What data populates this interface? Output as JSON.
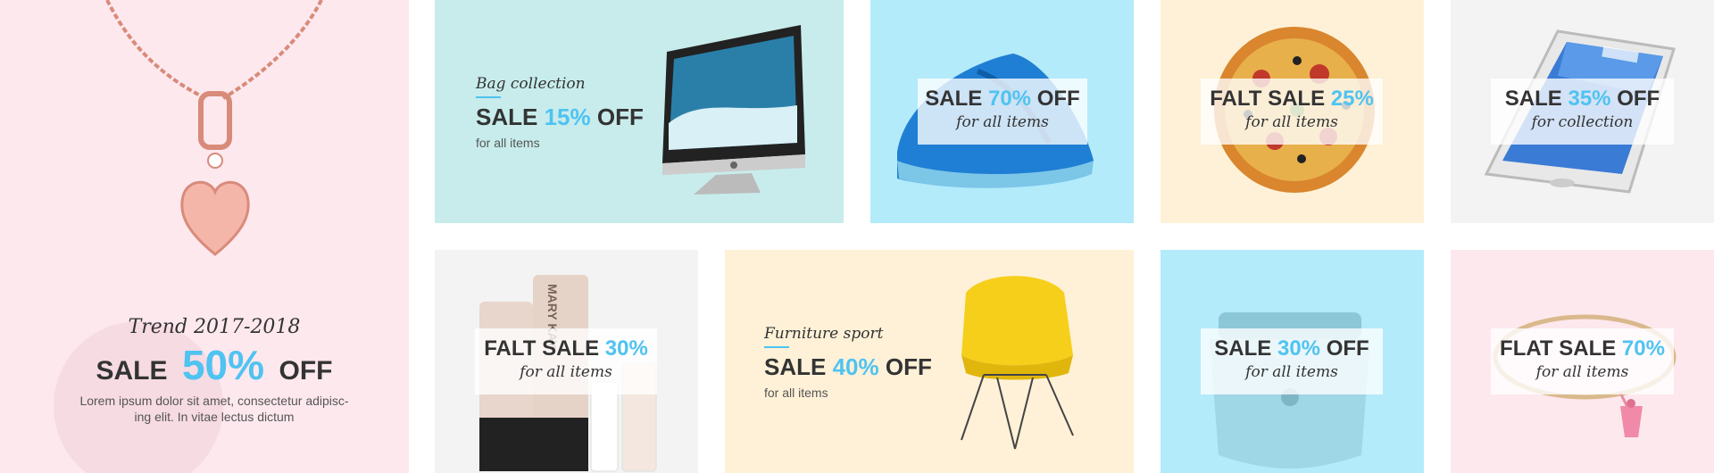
{
  "colors": {
    "accent": "#4fc3f1",
    "text": "#333333",
    "pink_bg": "#fde8ee",
    "mint_bg": "#c8ecec",
    "sky_bg": "#b3ebfb",
    "cream_bg": "#fef1d7",
    "grey_bg": "#f3f3f3"
  },
  "hero": {
    "script": "Trend 2017-2018",
    "sale_prefix": "SALE",
    "sale_pct": "50%",
    "sale_suffix": "OFF",
    "desc_line1": "Lorem ipsum dolor sit amet, consectetur adipisc-",
    "desc_line2": "ing elit. In vitae lectus dictum",
    "image_icon": "pendant-necklace-icon"
  },
  "tiles": {
    "imac": {
      "script": "Bag collection",
      "prefix": "SALE",
      "pct": "15%",
      "suffix": "OFF",
      "sub": "for all items",
      "icon": "imac-icon"
    },
    "shoes": {
      "prefix": "SALE",
      "pct": "70%",
      "suffix": "OFF",
      "sub": "for all items",
      "icon": "sneaker-icon"
    },
    "pizza": {
      "prefix": "FALT SALE",
      "pct": "25%",
      "sub": "for all items",
      "icon": "pizza-icon"
    },
    "phone": {
      "prefix": "SALE",
      "pct": "35%",
      "suffix": "OFF",
      "sub": "for collection",
      "icon": "smartphone-icon"
    },
    "cosmetics": {
      "prefix": "FALT SALE",
      "pct": "30%",
      "sub": "for all items",
      "icon": "cosmetics-icon",
      "brand": "MARY KAY"
    },
    "chair": {
      "script": "Furniture sport",
      "prefix": "SALE",
      "pct": "40%",
      "suffix": "OFF",
      "sub": "for all items",
      "icon": "chair-icon"
    },
    "bag": {
      "prefix": "SALE",
      "pct": "30%",
      "suffix": "OFF",
      "sub": "for all items",
      "icon": "handbag-icon"
    },
    "bracelet": {
      "prefix": "FLAT SALE",
      "pct": "70%",
      "sub": "for all items",
      "icon": "bracelet-icon"
    }
  }
}
